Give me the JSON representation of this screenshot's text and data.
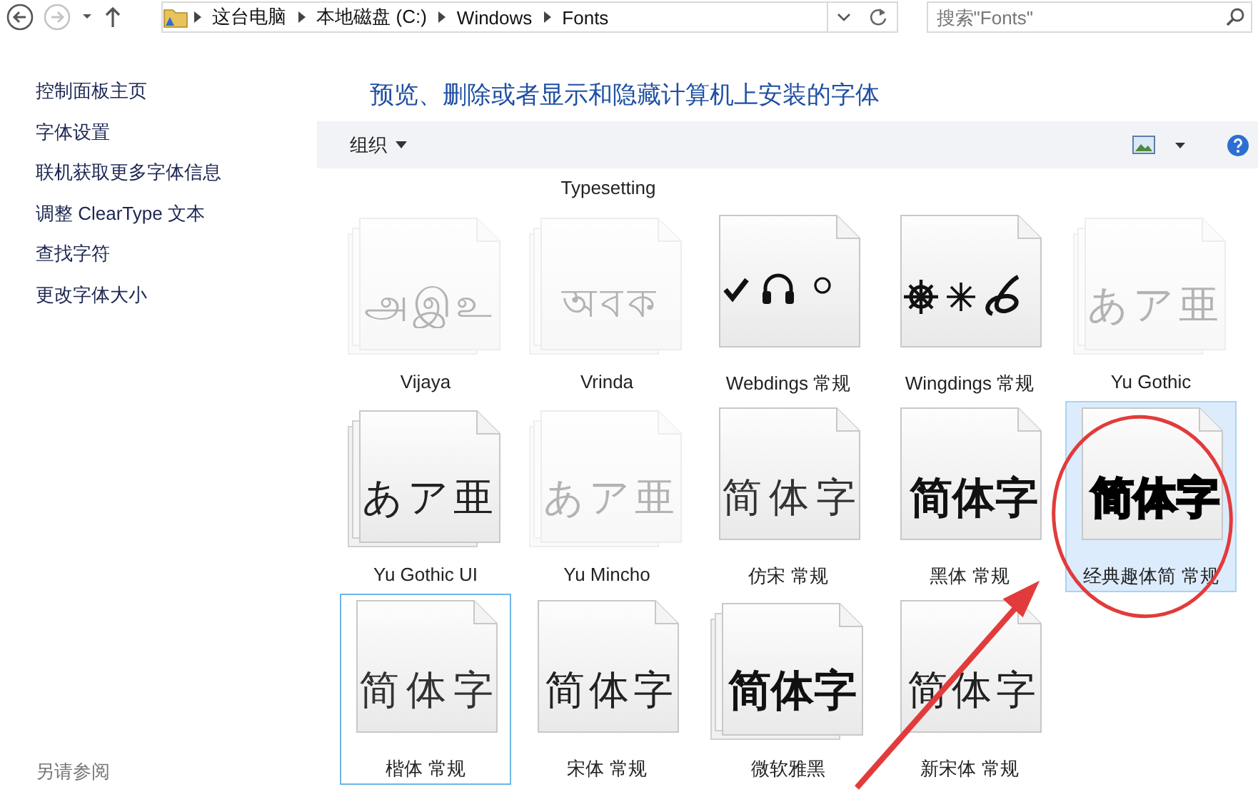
{
  "address_bar": {
    "nav": [
      {
        "kind": "back",
        "disabled": false
      },
      {
        "kind": "forward",
        "disabled": true
      },
      {
        "kind": "recent",
        "disabled": false
      },
      {
        "kind": "up",
        "disabled": false
      }
    ],
    "breadcrumbs": [
      "这台电脑",
      "本地磁盘 (C:)",
      "Windows",
      "Fonts"
    ],
    "search": {
      "placeholder": "搜索\"Fonts\""
    }
  },
  "sidebar": {
    "items": [
      "控制面板主页",
      "字体设置",
      "联机获取更多字体信息",
      "调整 ClearType 文本",
      "查找字符",
      "更改字体大小"
    ],
    "see_also": "另请参阅"
  },
  "title": "预览、删除或者显示和隐藏计算机上安装的字体",
  "toolbar": {
    "organize": "组织"
  },
  "partial_row": {
    "text": "Typesetting"
  },
  "fonts": [
    {
      "name": "Vijaya",
      "preview": {
        "kind": "regular-text",
        "text": "அஇஉ"
      },
      "family": true,
      "hidden": true,
      "selected": false,
      "focused": false
    },
    {
      "name": "Vrinda",
      "preview": {
        "kind": "regular-text",
        "text": "অবক"
      },
      "family": true,
      "hidden": true,
      "selected": false,
      "focused": false
    },
    {
      "name": "Webdings 常规",
      "preview": {
        "kind": "webdings"
      },
      "family": false,
      "hidden": false,
      "selected": false,
      "focused": false
    },
    {
      "name": "Wingdings 常规",
      "preview": {
        "kind": "wingdings"
      },
      "family": false,
      "hidden": false,
      "selected": false,
      "focused": false
    },
    {
      "name": "Yu Gothic",
      "preview": {
        "kind": "regular-text",
        "text": "あア亜"
      },
      "family": true,
      "hidden": true,
      "selected": false,
      "focused": false
    },
    {
      "name": "Yu Gothic UI",
      "preview": {
        "kind": "regular-text",
        "text": "あア亜"
      },
      "family": true,
      "hidden": false,
      "selected": false,
      "focused": false
    },
    {
      "name": "Yu Mincho",
      "preview": {
        "kind": "regular-text",
        "text": "あア亜"
      },
      "family": true,
      "hidden": true,
      "selected": false,
      "focused": false
    },
    {
      "name": "仿宋 常规",
      "preview": {
        "kind": "light-text",
        "text": "简体字"
      },
      "family": false,
      "hidden": false,
      "selected": false,
      "focused": false
    },
    {
      "name": "黑体 常规",
      "preview": {
        "kind": "bold-text",
        "text": "简体字"
      },
      "family": false,
      "hidden": false,
      "selected": false,
      "focused": false
    },
    {
      "name": "经典趣体简 常规",
      "preview": {
        "kind": "heavy-text",
        "text": "简体字"
      },
      "family": false,
      "hidden": false,
      "selected": true,
      "focused": false
    },
    {
      "name": "楷体 常规",
      "preview": {
        "kind": "light-text",
        "text": "简体字"
      },
      "family": false,
      "hidden": false,
      "selected": false,
      "focused": true
    },
    {
      "name": "宋体 常规",
      "preview": {
        "kind": "regular-text",
        "text": "简体字"
      },
      "family": false,
      "hidden": false,
      "selected": false,
      "focused": false
    },
    {
      "name": "微软雅黑",
      "preview": {
        "kind": "bold-text",
        "text": "简体字"
      },
      "family": true,
      "hidden": false,
      "selected": false,
      "focused": false
    },
    {
      "name": "新宋体 常规",
      "preview": {
        "kind": "regular-text",
        "text": "简体字"
      },
      "family": false,
      "hidden": false,
      "selected": false,
      "focused": false
    }
  ],
  "annotations": [
    {
      "kind": "circle"
    },
    {
      "kind": "arrow"
    }
  ]
}
